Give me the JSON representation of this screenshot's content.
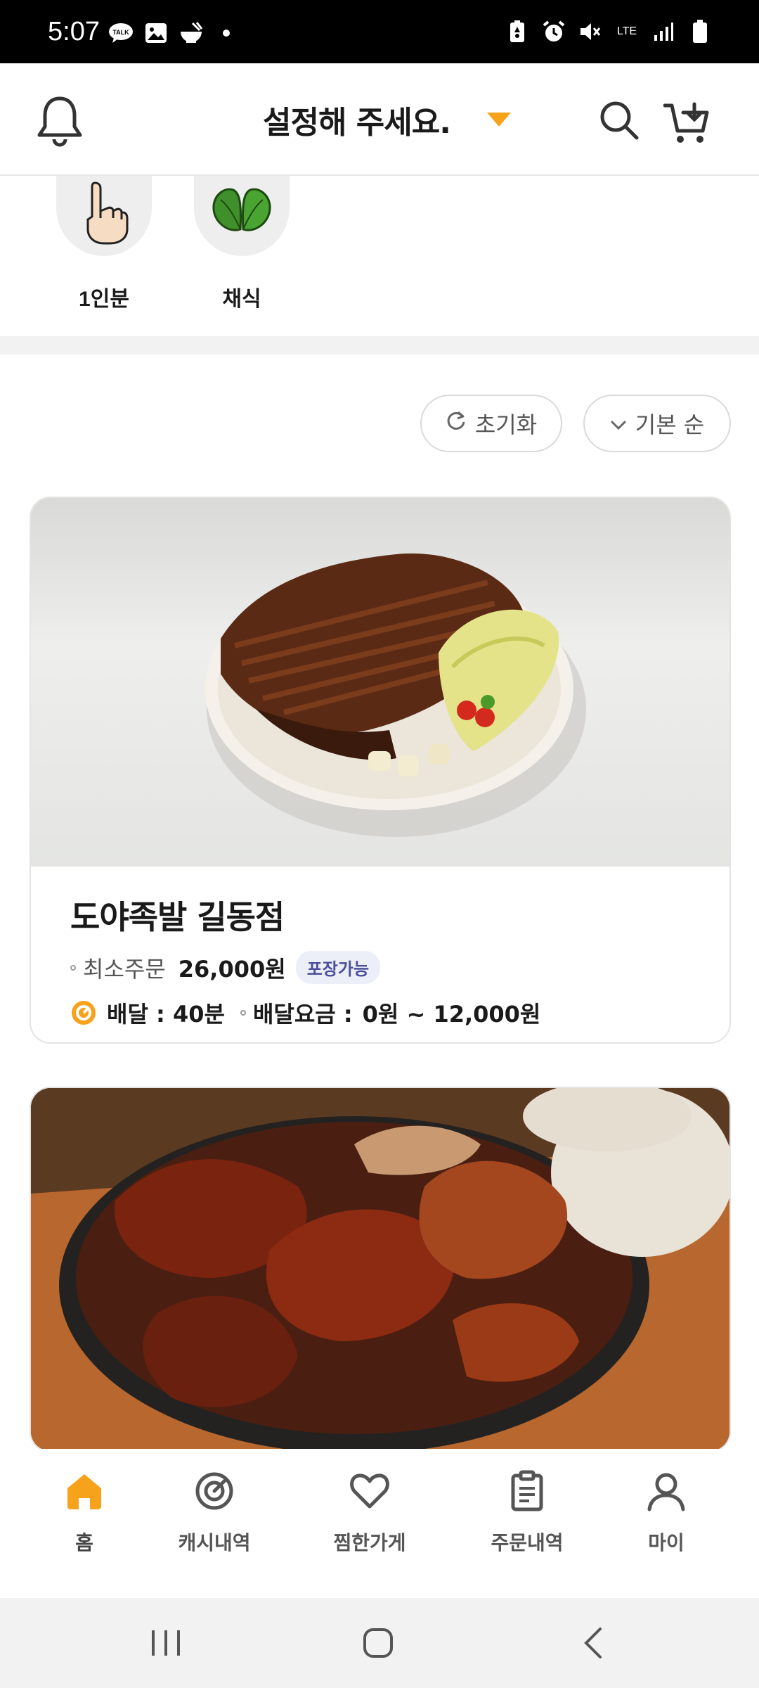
{
  "status_bar": {
    "time": "5:07",
    "network": "LTE"
  },
  "header": {
    "location_prompt": "설정해 주세요."
  },
  "categories": [
    {
      "label": "1인분",
      "icon": "pointing-finger-icon"
    },
    {
      "label": "채식",
      "icon": "leaf-icon"
    }
  ],
  "filters": {
    "reset_label": "초기화",
    "sort_label": "기본 순"
  },
  "restaurants": [
    {
      "name": "도야족발 길동점",
      "min_order_label": "최소주문",
      "min_order_value": "26,000원",
      "badge": "포장가능",
      "delivery_time": "배달 : 40분",
      "delivery_fee_label": "배달요금 :",
      "delivery_fee_value": "0원 ~ 12,000원"
    },
    {
      "name": ""
    }
  ],
  "bottom_nav": [
    {
      "label": "홈",
      "icon": "home-icon",
      "active": true
    },
    {
      "label": "캐시내역",
      "icon": "cash-history-icon"
    },
    {
      "label": "찜한가게",
      "icon": "heart-icon"
    },
    {
      "label": "주문내역",
      "icon": "clipboard-icon"
    },
    {
      "label": "마이",
      "icon": "person-icon"
    }
  ],
  "colors": {
    "accent": "#f7a21b",
    "badge_bg": "#eceef8",
    "badge_text": "#4b4f9a"
  }
}
